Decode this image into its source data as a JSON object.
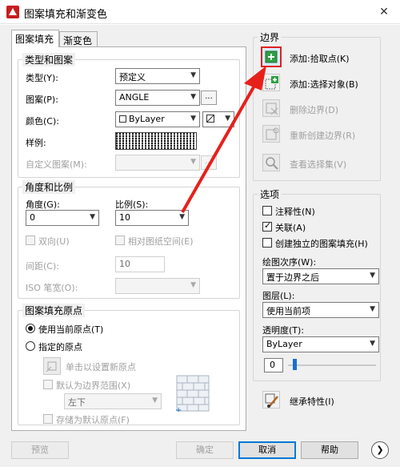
{
  "window": {
    "title": "图案填充和渐变色",
    "close": "✕"
  },
  "tabs": [
    {
      "label": "图案填充"
    },
    {
      "label": "渐变色"
    }
  ],
  "pattern_group": {
    "title": "类型和图案",
    "type_label": "类型(Y):",
    "type_value": "预定义",
    "pattern_label": "图案(P):",
    "pattern_value": "ANGLE",
    "color_label": "颜色(C):",
    "color_value": "ByLayer",
    "swatch_label": "样例:",
    "custom_label": "自定义图案(M):",
    "ellipsis": "..."
  },
  "angle_group": {
    "title": "角度和比例",
    "angle_label": "角度(G):",
    "angle_value": "0",
    "scale_label": "比例(S):",
    "scale_value": "10",
    "double_label": "双向(U)",
    "relative_label": "相对图纸空间(E)",
    "spacing_label": "间距(C):",
    "spacing_value": "10",
    "iso_label": "ISO 笔宽(O):"
  },
  "origin_group": {
    "title": "图案填充原点",
    "current_label": "使用当前原点(T)",
    "specified_label": "指定的原点",
    "click_set_label": "单击以设置新原点",
    "default_extents_label": "默认为边界范围(X)",
    "position_value": "左下",
    "store_default_label": "存储为默认原点(F)"
  },
  "boundary": {
    "title": "边界",
    "add_pick": "添加:拾取点(K)",
    "add_select": "添加:选择对象(B)",
    "remove": "删除边界(D)",
    "recreate": "重新创建边界(R)",
    "view_selection": "查看选择集(V)"
  },
  "options": {
    "title": "选项",
    "annotative": "注释性(N)",
    "associative": "关联(A)",
    "separate": "创建独立的图案填充(H)",
    "draw_order_label": "绘图次序(W):",
    "draw_order_value": "置于边界之后",
    "layer_label": "图层(L):",
    "layer_value": "使用当前项",
    "transparency_label": "透明度(T):",
    "transparency_value": "ByLayer",
    "transparency_amount": "0"
  },
  "inherit": {
    "label": "继承特性(I)"
  },
  "footer": {
    "preview": "预览",
    "ok": "确定",
    "cancel": "取消",
    "help": "帮助"
  },
  "colors": {
    "annotation_arrow": "#e8201a",
    "accent": "#0078d7"
  }
}
